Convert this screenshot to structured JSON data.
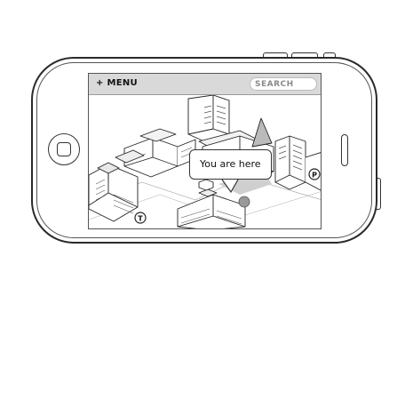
{
  "navbar": {
    "menu_label": "+ MENU",
    "search_placeholder": "SEARCH"
  },
  "map": {
    "location_callout": "You are here",
    "marker_transit": "T",
    "marker_parking": "P"
  },
  "colors": {
    "topbar": "#d9d9d9",
    "location_dot": "#999999",
    "outline": "#2a2a2a"
  }
}
